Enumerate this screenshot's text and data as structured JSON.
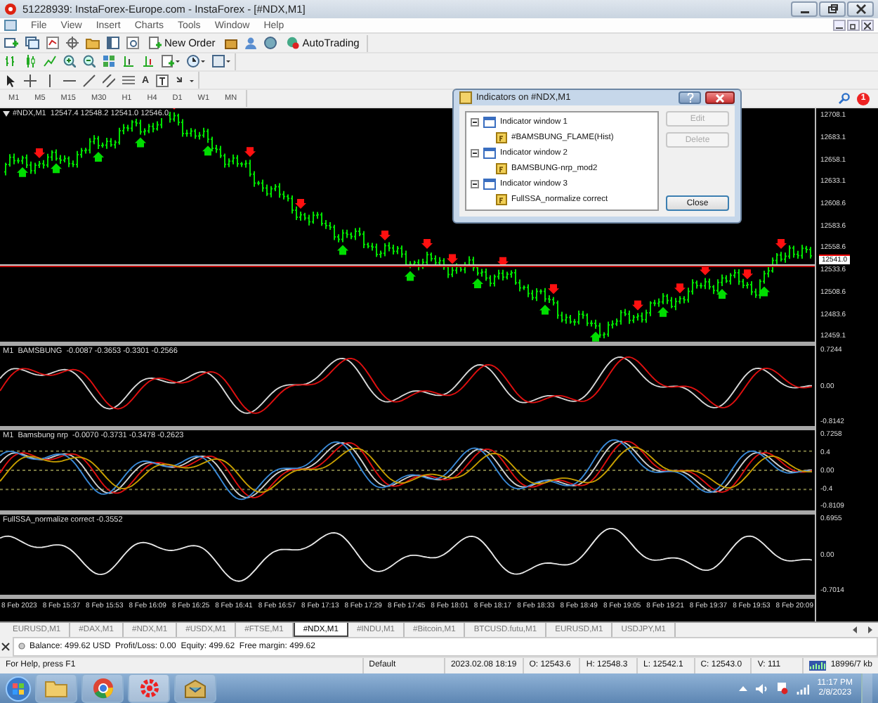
{
  "window": {
    "title": "51228939: InstaForex-Europe.com - InstaForex - [#NDX,M1]"
  },
  "menu": [
    "File",
    "View",
    "Insert",
    "Charts",
    "Tools",
    "Window",
    "Help"
  ],
  "notification_count": "1",
  "toolbar": {
    "new_order": "New Order",
    "autotrading": "AutoTrading"
  },
  "drawing_tools": {
    "text_tool": "A"
  },
  "timeframes": [
    "M1",
    "M5",
    "M15",
    "M30",
    "H1",
    "H4",
    "D1",
    "W1",
    "MN"
  ],
  "chart": {
    "header": "#NDX,M1  12547.4 12548.2 12541.0 12546.0",
    "price_axis": [
      "12708.1",
      "12683.1",
      "12658.1",
      "12633.1",
      "12608.6",
      "12583.6",
      "12558.6",
      "12533.6",
      "12508.6",
      "12483.6",
      "12459.1"
    ],
    "current_price": "12541.0"
  },
  "indicator_panes": [
    {
      "header": "M1  BAMSBUNG  -0.0087 -0.3653 -0.3301 -0.2566",
      "axis": [
        "0.7244",
        "0.00",
        "-0.8142"
      ]
    },
    {
      "header": "M1  Bamsbung nrp  -0.0070 -0.3731 -0.3478 -0.2623",
      "axis": [
        "0.7258",
        "0.4",
        "0.00",
        "-0.4",
        "-0.8109"
      ]
    },
    {
      "header": "FullSSA_normalize correct -0.3552",
      "axis": [
        "0.6955",
        "0.00",
        "-0.7014"
      ]
    }
  ],
  "time_axis": [
    "8 Feb 2023",
    "8 Feb 15:37",
    "8 Feb 15:53",
    "8 Feb 16:09",
    "8 Feb 16:25",
    "8 Feb 16:41",
    "8 Feb 16:57",
    "8 Feb 17:13",
    "8 Feb 17:29",
    "8 Feb 17:45",
    "8 Feb 18:01",
    "8 Feb 18:17",
    "8 Feb 18:33",
    "8 Feb 18:49",
    "8 Feb 19:05",
    "8 Feb 19:21",
    "8 Feb 19:37",
    "8 Feb 19:53",
    "8 Feb 20:09"
  ],
  "dialog": {
    "title": "Indicators on #NDX,M1",
    "tree": [
      {
        "label": "Indicator window 1",
        "expanded": true,
        "children": [
          {
            "label": "#BAMSBUNG_FLAME(Hist)"
          }
        ]
      },
      {
        "label": "Indicator window 2",
        "expanded": true,
        "children": [
          {
            "label": "BAMSBUNG-nrp_mod2"
          }
        ]
      },
      {
        "label": "Indicator window 3",
        "expanded": true,
        "children": [
          {
            "label": "FullSSA_normalize correct"
          }
        ]
      }
    ],
    "buttons": [
      {
        "label": "Edit",
        "disabled": true
      },
      {
        "label": "Delete",
        "disabled": true
      },
      {
        "label": "Close",
        "disabled": false
      }
    ]
  },
  "chart_tabs": [
    {
      "label": "EURUSD,M1",
      "selected": false
    },
    {
      "label": "#DAX,M1",
      "selected": false
    },
    {
      "label": "#NDX,M1",
      "selected": false
    },
    {
      "label": "#USDX,M1",
      "selected": false
    },
    {
      "label": "#FTSE,M1",
      "selected": false
    },
    {
      "label": "#NDX,M1",
      "selected": true
    },
    {
      "label": "#INDU,M1",
      "selected": false
    },
    {
      "label": "#Bitcoin,M1",
      "selected": false
    },
    {
      "label": "BTCUSD.futu,M1",
      "selected": false
    },
    {
      "label": "EURUSD,M1",
      "selected": false
    },
    {
      "label": "USDJPY,M1",
      "selected": false
    }
  ],
  "terminal": {
    "text": "Balance: 499.62 USD  Profit/Loss: 0.00  Equity: 499.62  Free margin: 499.62"
  },
  "status_bar": {
    "help": "For Help, press F1",
    "profile": "Default",
    "datetime": "2023.02.08 18:19",
    "open": "O: 12543.6",
    "high": "H: 12548.3",
    "low": "L: 12542.1",
    "close": "C: 12543.0",
    "volume": "V: 111",
    "traffic": "18996/7 kb"
  },
  "taskbar": {
    "time": "11:17 PM",
    "date": "2/8/2023"
  }
}
